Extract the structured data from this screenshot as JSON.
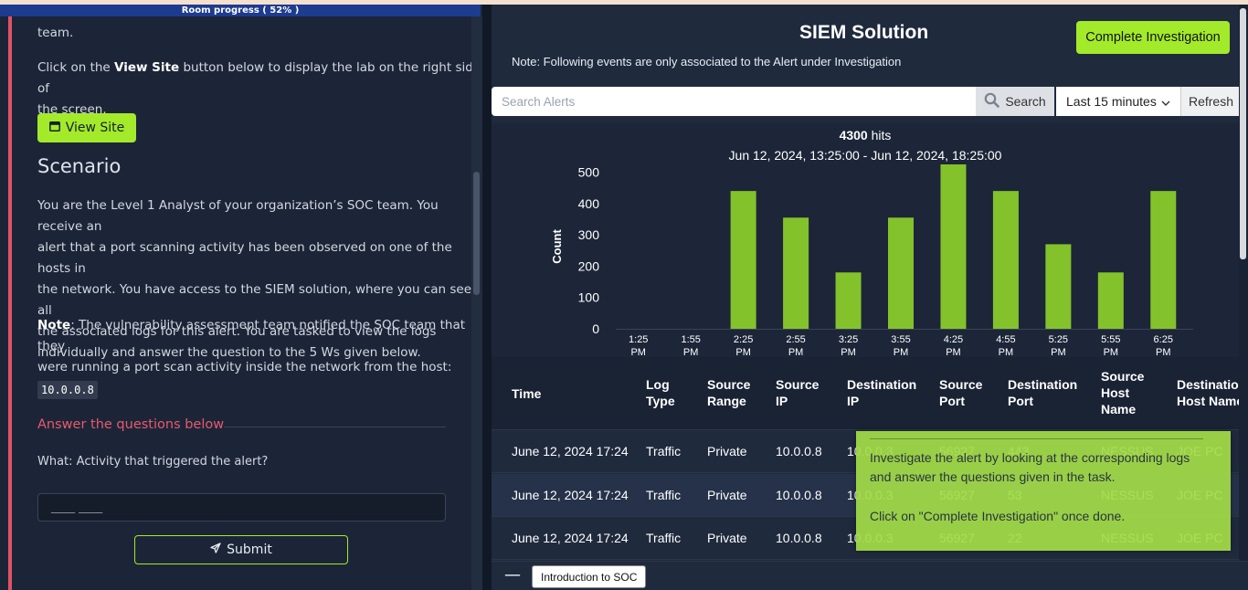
{
  "progress": {
    "label": "Room progress ( 52% )",
    "value_percent": 52
  },
  "left": {
    "top_fragment": "team.",
    "instruction_pre": "Click on the ",
    "instruction_bold": "View Site",
    "instruction_post_1": " button below to display the lab on the right side of",
    "instruction_post_2": "the screen.",
    "view_site_label": "View Site",
    "scenario_heading": "Scenario",
    "p1": [
      "You are the Level 1 Analyst of your organization’s SOC team. You receive an",
      "alert that a port scanning activity has been observed on one of the hosts in",
      "the network. You have access to the SIEM solution, where you can see all",
      "the associated logs for this alert. You are tasked to view the logs",
      "individually and answer the question to the 5 Ws given below."
    ],
    "note_label": "Note",
    "note_lines": [
      ": The vulnerability assessment team notified the SOC team that they",
      "were running a port scan activity inside the network from the host:"
    ],
    "host_ip": "10.0.0.8",
    "answer_heading": "Answer the questions below",
    "question": "What: Activity that triggered the alert?",
    "answer_placeholder": "____ ____",
    "submit_label": "Submit"
  },
  "siem": {
    "title": "SIEM Solution",
    "complete_label": "Complete Investigation",
    "note": "Note: Following events are only associated to the Alert under Investigation",
    "search_placeholder": "Search Alerts",
    "search_label": "Search",
    "time_range": "Last 15 minutes",
    "refresh_label": "Refresh",
    "hits_count": "4300",
    "hits_suffix": " hits",
    "range_text": "Jun 12, 2024, 13:25:00 - Jun 12, 2024, 18:25:00"
  },
  "chart_data": {
    "type": "bar",
    "categories": [
      "1:25 PM",
      "1:55 PM",
      "2:25 PM",
      "2:55 PM",
      "3:25 PM",
      "3:55 PM",
      "4:25 PM",
      "4:55 PM",
      "5:25 PM",
      "5:55 PM",
      "6:25 PM"
    ],
    "values": [
      0,
      0,
      440,
      355,
      180,
      355,
      525,
      440,
      270,
      180,
      440
    ],
    "ylabel": "Count",
    "yticks": [
      0,
      100,
      200,
      300,
      400,
      500
    ],
    "ylim": [
      0,
      525
    ],
    "bar_color": "#84c22c"
  },
  "table": {
    "headers": [
      [
        "Time"
      ],
      [
        "Log",
        "Type"
      ],
      [
        "Source",
        "Range"
      ],
      [
        "Source",
        "IP"
      ],
      [
        "Destination",
        "IP"
      ],
      [
        "Source",
        "Port"
      ],
      [
        "Destination",
        "Port"
      ],
      [
        "Source",
        "Host",
        "Name"
      ],
      [
        "Destination",
        "Host Name"
      ]
    ],
    "rows": [
      [
        "June 12, 2024 17:24",
        "Traffic",
        "Private",
        "10.0.0.8",
        "10.0.0.3",
        "56927",
        "443",
        "NESSUS",
        "JOE PC"
      ],
      [
        "June 12, 2024 17:24",
        "Traffic",
        "Private",
        "10.0.0.8",
        "10.0.0.3",
        "56927",
        "53",
        "NESSUS",
        "JOE PC"
      ],
      [
        "June 12, 2024 17:24",
        "Traffic",
        "Private",
        "10.0.0.8",
        "10.0.0.3",
        "56927",
        "22",
        "NESSUS",
        "JOE PC"
      ]
    ]
  },
  "tooltip": {
    "line1": "Investigate the alert by looking at the corresponding logs",
    "line2": "and answer the questions given in the task.",
    "line3": "Click on \"Complete Investigation\" once done."
  },
  "bottom": {
    "minus": "—",
    "tab_label": "Introduction to SOC"
  },
  "colors": {
    "accent": "#a3ea2a",
    "danger": "#e05264",
    "panel": "#1c2538"
  }
}
